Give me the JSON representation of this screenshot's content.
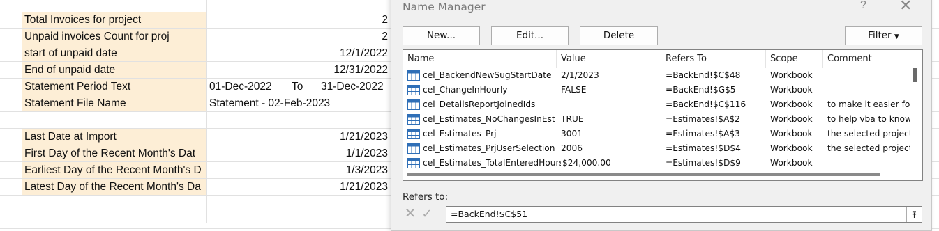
{
  "sheet": {
    "rows": [
      {
        "label": "Total Invoices for project",
        "value": "2",
        "fill": true
      },
      {
        "label": "Unpaid invoices Count for proj",
        "value": "2",
        "fill": true
      },
      {
        "label": "start of unpaid date",
        "value": "12/1/2022",
        "fill": true
      },
      {
        "label": "End of unpaid date",
        "value": "12/31/2022",
        "fill": true
      },
      {
        "label": "Statement Period Text",
        "value": "",
        "fill": true
      },
      {
        "label": "Statement File Name",
        "value": "Statement - 02-Feb-2023",
        "fill": true
      },
      {
        "label": "",
        "value": "",
        "fill": false
      },
      {
        "label": "Last Date at Import",
        "value": "1/21/2023",
        "fill": true
      },
      {
        "label": "First Day of the Recent Month's Dat",
        "value": "1/1/2023",
        "fill": true
      },
      {
        "label": "Earliest Day of the Recent Month's D",
        "value": "1/3/2023",
        "fill": true
      },
      {
        "label": "Latest Day of the Recent Month's Da",
        "value": "1/21/2023",
        "fill": true
      }
    ],
    "period": {
      "from": "01-Dec-2022",
      "to_word": "To",
      "to": "31-Dec-2022"
    },
    "fill_color": "#fdeed6"
  },
  "dialog": {
    "title": "Name Manager",
    "help": "?",
    "close": "✕",
    "buttons": {
      "new": "New...",
      "edit": "Edit...",
      "delete": "Delete",
      "filter": "Filter"
    },
    "columns": [
      "Name",
      "Value",
      "Refers To",
      "Scope",
      "Comment"
    ],
    "names": [
      {
        "name": "cel_BackendNewSugStartDate",
        "value": "2/1/2023",
        "refers": "=BackEnd!$C$48",
        "scope": "Workbook",
        "comment": ""
      },
      {
        "name": "cel_ChangeInHourly",
        "value": "FALSE",
        "refers": "=BackEnd!$G$5",
        "scope": "Workbook",
        "comment": ""
      },
      {
        "name": "cel_DetailsReportJoinedIds",
        "value": "",
        "refers": "=BackEnd!$C$116",
        "scope": "Workbook",
        "comment": "to make it easier for"
      },
      {
        "name": "cel_Estimates_NoChangesInEsti...",
        "value": "TRUE",
        "refers": "=Estimates!$A$2",
        "scope": "Workbook",
        "comment": "to help vba to know"
      },
      {
        "name": "cel_Estimates_Prj",
        "value": "3001",
        "refers": "=Estimates!$A$3",
        "scope": "Workbook",
        "comment": "the selected project"
      },
      {
        "name": "cel_Estimates_PrjUserSelection",
        "value": "2006",
        "refers": "=Estimates!$D$4",
        "scope": "Workbook",
        "comment": "the selected project"
      },
      {
        "name": "cel_Estimates_TotalEnteredHours",
        "value": "$24,000.00",
        "refers": "=Estimates!$D$9",
        "scope": "Workbook",
        "comment": ""
      }
    ],
    "refers_to_label": "Refers to:",
    "refers_to_value": "=BackEnd!$C$51"
  }
}
